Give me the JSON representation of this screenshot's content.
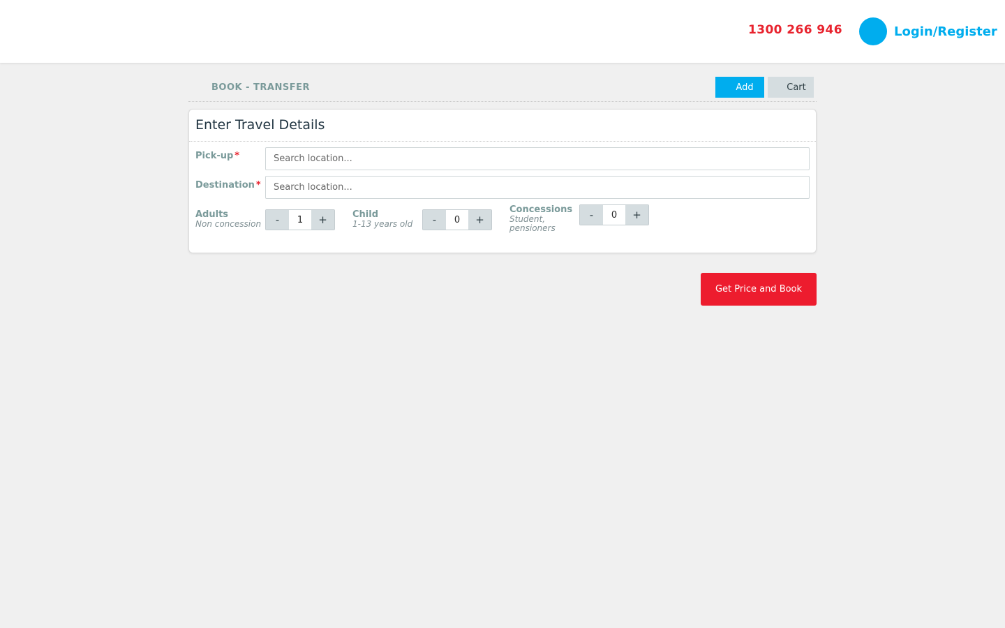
{
  "header": {
    "phone": "1300 266 946",
    "login_label": "Login/Register"
  },
  "breadcrumb": {
    "title": "BOOK - TRANSFER",
    "add_label": "Add",
    "cart_label": "Cart"
  },
  "form": {
    "title": "Enter Travel Details",
    "pickup": {
      "label": "Pick-up",
      "required_mark": "*",
      "placeholder": "Search location...",
      "value": ""
    },
    "destination": {
      "label": "Destination",
      "required_mark": "*",
      "placeholder": "Search location...",
      "value": ""
    },
    "adults": {
      "label": "Adults",
      "sublabel": "Non concession",
      "value": "1",
      "minus": "-",
      "plus": "+"
    },
    "child": {
      "label": "Child",
      "sublabel": "1-13 years old",
      "value": "0",
      "minus": "-",
      "plus": "+"
    },
    "concessions": {
      "label": "Concessions",
      "sublabel_line1": "Student,",
      "sublabel_line2": "pensioners",
      "value": "0",
      "minus": "-",
      "plus": "+"
    }
  },
  "actions": {
    "book_label": "Get Price and Book"
  },
  "colors": {
    "accent_blue": "#00adee",
    "accent_red": "#ed1c2e",
    "phone_red": "#e8232e",
    "label_gray": "#7a9a9a",
    "background": "#f0f0f0"
  },
  "icons": {
    "avatar": "user-avatar-icon"
  }
}
